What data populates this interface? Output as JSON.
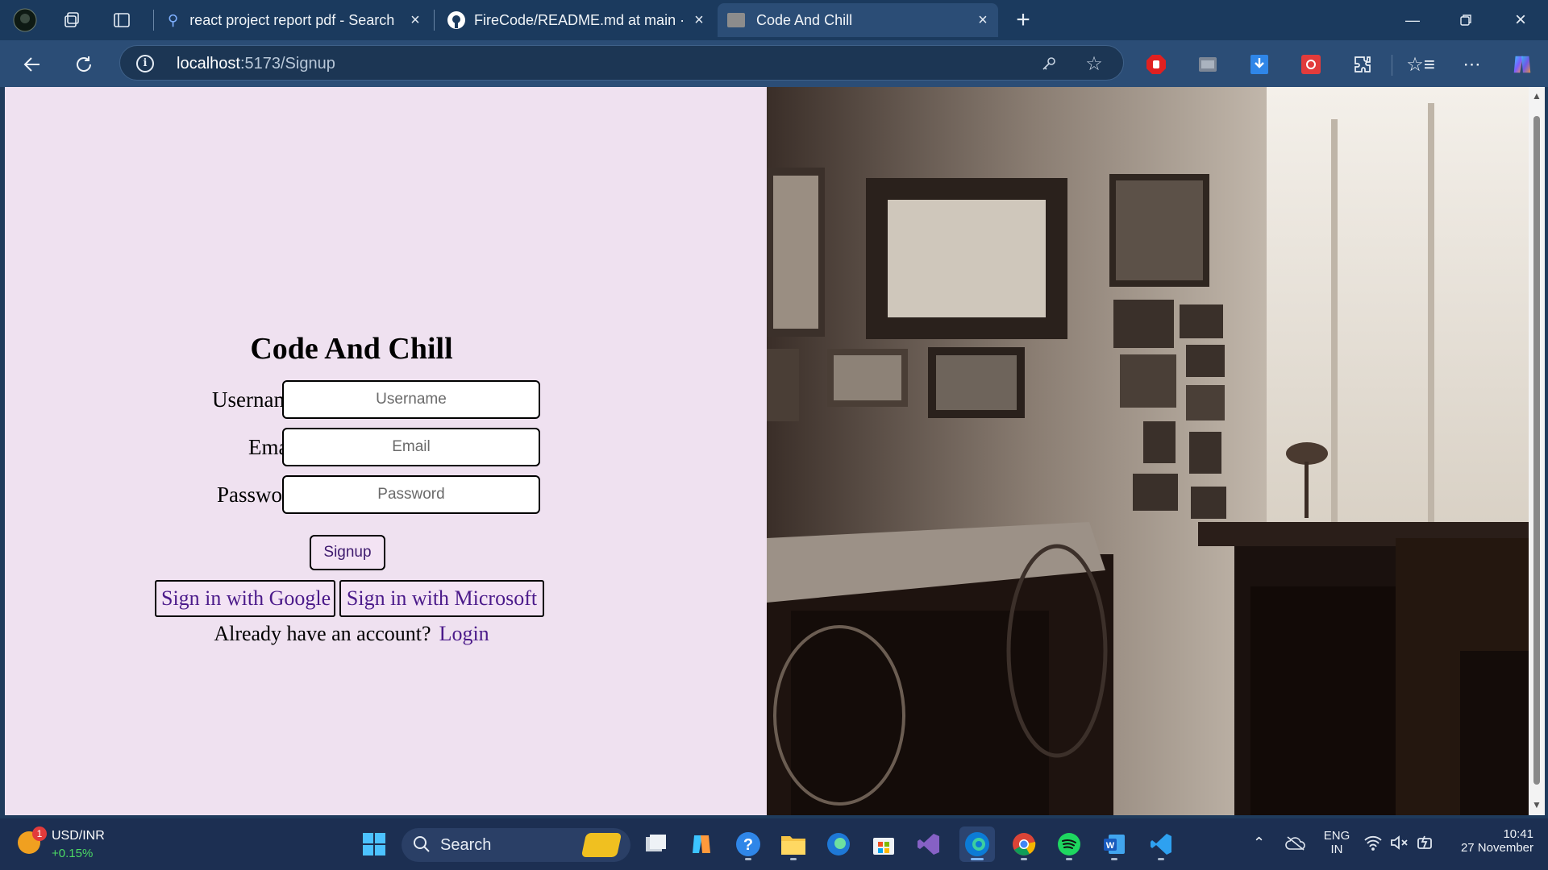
{
  "browser": {
    "tabs": [
      {
        "title": "react project report pdf - Search",
        "icon": "search-icon"
      },
      {
        "title": "FireCode/README.md at main · M",
        "icon": "github-icon"
      },
      {
        "title": "Code And Chill",
        "icon": "page-favicon",
        "active": true
      }
    ],
    "address": {
      "host": "localhost",
      "rest": ":5173/Signup"
    }
  },
  "page": {
    "title": "Code And Chill",
    "fields": [
      {
        "label": "Username:",
        "placeholder": "Username"
      },
      {
        "label": "Email:",
        "placeholder": "Email"
      },
      {
        "label": "Password:",
        "placeholder": "Password"
      }
    ],
    "signup_label": "Signup",
    "google_label": "Sign in with Google",
    "microsoft_label": "Sign in with Microsoft",
    "have_account": "Already have an account?",
    "login_label": "Login",
    "background": "#efe1f0",
    "accent": "#4b1a8a"
  },
  "taskbar": {
    "widget": {
      "title": "USD/INR",
      "change": "+0.15%",
      "badge": "1"
    },
    "search_label": "Search",
    "lang": {
      "top": "ENG",
      "bottom": "IN"
    },
    "clock": {
      "time": "10:41",
      "date": "27 November"
    }
  }
}
